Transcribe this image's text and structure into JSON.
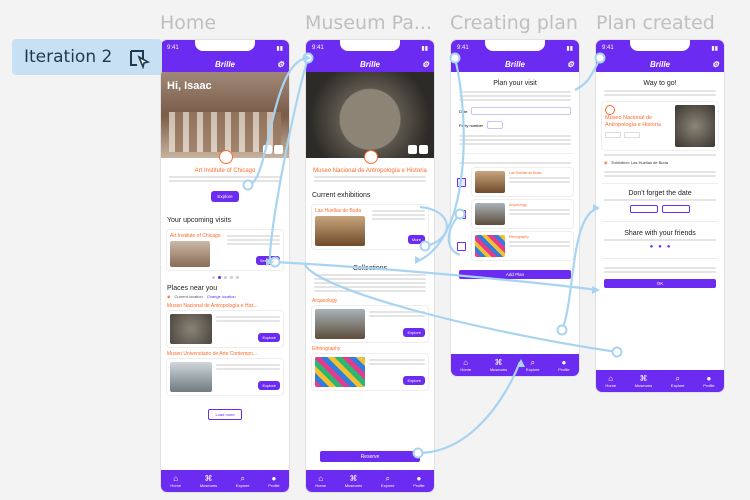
{
  "iteration_label": "Iteration 2",
  "frames": [
    {
      "title": "Home"
    },
    {
      "title": "Museum Pa..."
    },
    {
      "title": "Creating plan"
    },
    {
      "title": "Plan created"
    }
  ],
  "status_time": "9:41",
  "app_name": "Brille",
  "nav": [
    "Home",
    "Museums",
    "Explore",
    "Profile"
  ],
  "home": {
    "greeting": "Hi, Isaac",
    "featured_title": "Art Institute of Chicago",
    "explore_label": "Explore",
    "upcoming_heading": "Your upcoming visits",
    "upcoming_item": "Art Institute of Chicago",
    "see_plan_label": "See Plan",
    "places_heading": "Places near you",
    "current_location": "Current location",
    "change_location": "Change location",
    "places": [
      {
        "title": "Museo Nacional de Antropología e Hist..."
      },
      {
        "title": "Museo Universitario de Arte Contempo..."
      }
    ],
    "load_more": "Load more"
  },
  "museum": {
    "title": "Museo Nacional de Antropología e Historia",
    "exhibitions_heading": "Current exhibitions",
    "exhibition_name": "Las Huellas de Buda",
    "more_label": "More",
    "collections_heading": "Collections",
    "collection_items": [
      {
        "name": "Arqueology",
        "cta": "Explore"
      },
      {
        "name": "Ethnography",
        "cta": "Explore"
      }
    ],
    "reserve_label": "Reserve"
  },
  "creating": {
    "heading": "Plan your visit",
    "date_label": "Date",
    "party_label": "Party number",
    "checklist": [
      "Las Huellas de Buda",
      "Arqueology",
      "Ethnography"
    ],
    "add_plan_label": "Add Plan"
  },
  "created": {
    "heading": "Way to go!",
    "card_title": "Museo Nacional de Antropología e Historia",
    "exhibition_line": "Exhibition: Las Huellas de Buda",
    "forget_heading": "Don't forget the date",
    "share_heading": "Share with your friends",
    "ok_label": "OK"
  },
  "colors": {
    "brand": "#6b2bf0",
    "accent": "#ff6a2b",
    "flow": "#a8d4f2"
  }
}
